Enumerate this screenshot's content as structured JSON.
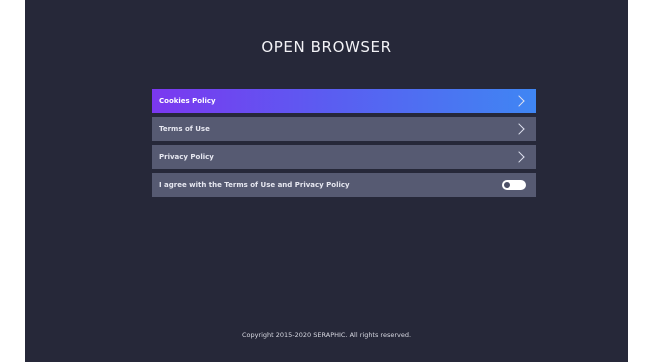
{
  "header": {
    "title": "OPEN BROWSER"
  },
  "menu": {
    "items": [
      {
        "label": "Cookies Policy"
      },
      {
        "label": "Terms of Use"
      },
      {
        "label": "Privacy Policy"
      }
    ],
    "agreement": {
      "label": "I agree with the Terms of Use and Privacy Policy",
      "enabled": false
    }
  },
  "footer": {
    "copyright": "Copyright 2015-2020 SERAPHIC. All rights reserved."
  },
  "colors": {
    "background": "#262839",
    "row": "#565a72",
    "active_gradient_start": "#7b38f0",
    "active_gradient_end": "#3f86f3"
  }
}
